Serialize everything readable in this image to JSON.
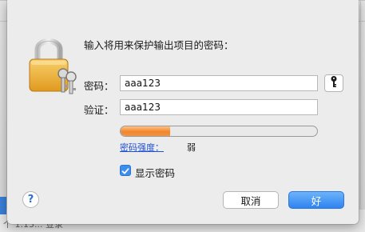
{
  "dialog": {
    "prompt": "输入将用来保护输出项目的密码：",
    "password_label": "密码：",
    "password_value": "aaa123",
    "verify_label": "验证：",
    "verify_value": "aaa123",
    "strength_label": "密码强度：",
    "strength_value": "弱",
    "strength_fraction": 0.25,
    "show_password_label": "显示密码",
    "show_password_checked": true,
    "help_label": "?",
    "cancel_label": "取消",
    "ok_label": "好"
  },
  "background": {
    "bottom_text": "个 1.13... 登录"
  },
  "icons": {
    "lock": "lock-with-keys-icon",
    "key": "key-icon",
    "check": "checkmark-icon"
  },
  "colors": {
    "accent": "#2f83f0",
    "meter_fill": "#f2862c",
    "link": "#1f4fd6"
  }
}
